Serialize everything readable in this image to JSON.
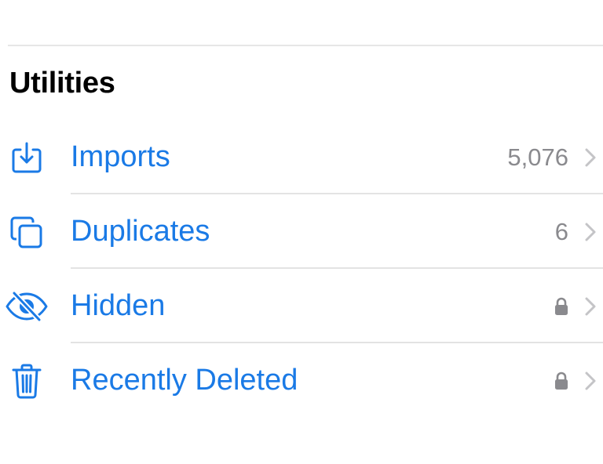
{
  "section": {
    "title": "Utilities"
  },
  "rows": [
    {
      "label": "Imports",
      "value": "5,076",
      "icon": "import-icon",
      "locked": false
    },
    {
      "label": "Duplicates",
      "value": "6",
      "icon": "duplicates-icon",
      "locked": false
    },
    {
      "label": "Hidden",
      "value": "",
      "icon": "hidden-eye-slash-icon",
      "locked": true
    },
    {
      "label": "Recently Deleted",
      "value": "",
      "icon": "trash-icon",
      "locked": true
    }
  ],
  "colors": {
    "accent": "#1a7ae6",
    "secondary_text": "#8a8a8e",
    "chevron": "#c4c4c7",
    "divider": "#e3e3e3"
  }
}
